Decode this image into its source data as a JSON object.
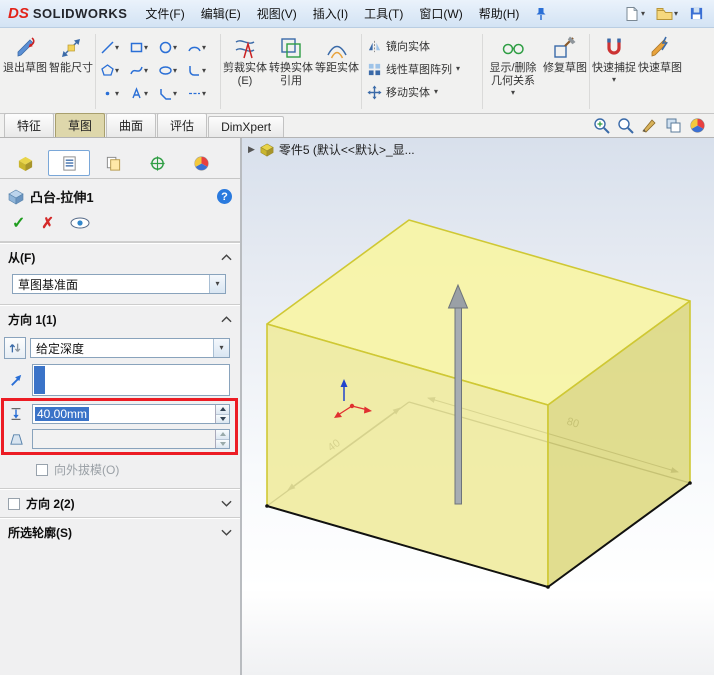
{
  "brand": {
    "logo": "DS",
    "name": "SOLIDWORKS"
  },
  "icons": {
    "dropdown": "▾",
    "confirm": "✓",
    "cancel": "✗",
    "help": "?",
    "breadcrumb_arrow": "▶"
  },
  "menubar": {
    "items": [
      "文件(F)",
      "编辑(E)",
      "视图(V)",
      "插入(I)",
      "工具(T)",
      "窗口(W)",
      "帮助(H)"
    ]
  },
  "ribbon": {
    "exit_sketch": "退出草图",
    "smart_dimension": "智能尺寸",
    "trim": "剪裁实体(E)",
    "convert": "转换实体引用",
    "offset": "等距实体",
    "mirror": "镜向实体",
    "linear_pattern": "线性草图阵列",
    "move": "移动实体",
    "relations": "显示/删除几何关系",
    "repair": "修复草图",
    "quick_snap": "快速捕捉",
    "quick_sketch": "快速草图"
  },
  "tabs": {
    "items": [
      "特征",
      "草图",
      "曲面",
      "评估",
      "DimXpert"
    ],
    "active_index": 1
  },
  "property_manager": {
    "title": "凸台-拉伸1",
    "from": {
      "header": "从(F)",
      "value": "草图基准面"
    },
    "direction1": {
      "header": "方向 1(1)",
      "end_condition": "给定深度",
      "depth_value": "40.00mm",
      "draft_value": "",
      "draft_checkbox": "向外拔模(O)"
    },
    "direction2": {
      "header": "方向 2(2)"
    },
    "selected_contours": {
      "header": "所选轮廓(S)"
    }
  },
  "viewport": {
    "breadcrumb": "零件5 (默认<<默认>_显...",
    "dim_width": "80",
    "dim_depth": "40"
  },
  "colors": {
    "annotation_red": "#ec1c24",
    "selection_blue": "#3a73c8",
    "preview_yellow": "#f7f3a4"
  }
}
